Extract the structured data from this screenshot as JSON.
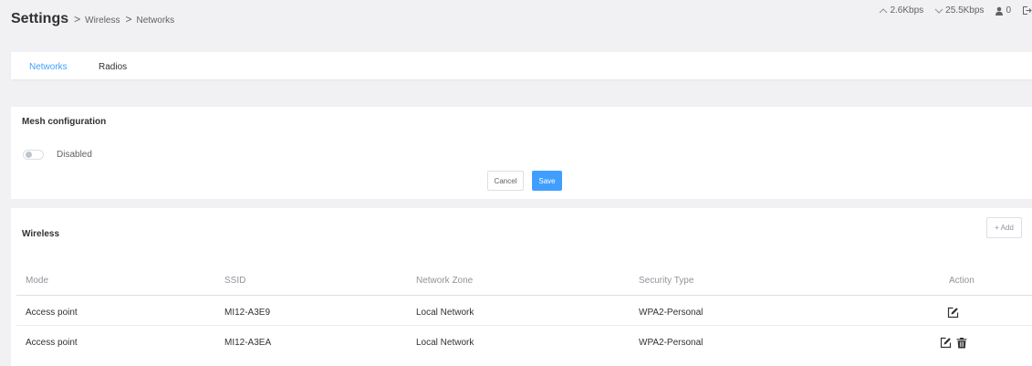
{
  "header": {
    "title": "Settings",
    "breadcrumb": [
      "Wireless",
      "Networks"
    ],
    "separator": ">"
  },
  "status": {
    "upload": "2.6Kbps",
    "download": "25.5Kbps",
    "users": "0"
  },
  "tabs": [
    {
      "label": "Networks",
      "active": true
    },
    {
      "label": "Radios",
      "active": false
    }
  ],
  "mesh": {
    "title": "Mesh configuration",
    "toggle_label": "Disabled",
    "enabled": false,
    "cancel_label": "Cancel",
    "save_label": "Save"
  },
  "wireless": {
    "title": "Wireless",
    "add_label": "+ Add",
    "columns": [
      "Mode",
      "SSID",
      "Network Zone",
      "Security Type",
      "Action"
    ],
    "rows": [
      {
        "mode": "Access point",
        "ssid": "MI12-A3E9",
        "zone": "Local Network",
        "security": "WPA2-Personal",
        "actions": [
          "edit"
        ]
      },
      {
        "mode": "Access point",
        "ssid": "MI12-A3EA",
        "zone": "Local Network",
        "security": "WPA2-Personal",
        "actions": [
          "edit",
          "delete"
        ]
      }
    ]
  },
  "colors": {
    "accent": "#409eff",
    "background": "#f1f1f3",
    "panel": "#ffffff",
    "text": "#303133",
    "muted": "#909399"
  },
  "icons": [
    "arrow-up-icon",
    "arrow-down-icon",
    "user-icon",
    "logout-icon",
    "edit-icon",
    "trash-icon"
  ]
}
